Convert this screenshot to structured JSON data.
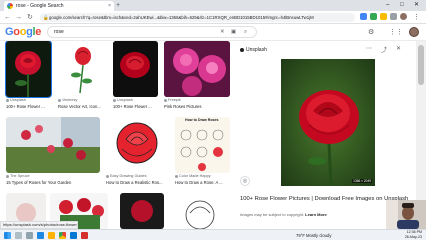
{
  "browser": {
    "tab_title": "rose - Google Search",
    "url": "google.com/search?q=rose&tbm=isch&ved=2ahUKEwi...&biw=1366&bih=625&rlz=1C1RXQR_enBD1015BD1015#imgrc=h4lBnsuwLTw1jM",
    "new_tab": "+",
    "tab_close": "×",
    "controls": {
      "minimize": "–",
      "maximize": "□",
      "close": "✕"
    }
  },
  "google": {
    "logo_letters": [
      {
        "ch": "G",
        "color": "#4285f4"
      },
      {
        "ch": "o",
        "color": "#ea4335"
      },
      {
        "ch": "o",
        "color": "#fbbc05"
      },
      {
        "ch": "g",
        "color": "#4285f4"
      },
      {
        "ch": "l",
        "color": "#34a853"
      },
      {
        "ch": "e",
        "color": "#ea4335"
      }
    ],
    "query": "rose"
  },
  "results": [
    {
      "source": "Unsplash",
      "title": "100+ Rose Flower ..."
    },
    {
      "source": "Vecteezy",
      "title": "Rose Vector Art, Icon..."
    },
    {
      "source": "Unsplash",
      "title": "100+ Rose Flower ..."
    },
    {
      "source": "Freepik",
      "title": "Pink Roses Pictures"
    },
    {
      "source": "The Spruce",
      "title": "15 Types of Roses for Your Garden"
    },
    {
      "source": "Easy Drawing Guides",
      "title": "How to Draw a Realistic Ros..."
    },
    {
      "source": "Color Made Happy",
      "title": "How to Draw a Rose: A ..."
    },
    {
      "source": "",
      "title": ""
    },
    {
      "source": "",
      "title": ""
    },
    {
      "source": "",
      "title": ""
    },
    {
      "source": "",
      "title": ""
    }
  ],
  "panel": {
    "source": "Unsplash",
    "image_size": "1366 × 2049",
    "title": "100+ Rose Flower Pictures | Download Free Images on Unsplash",
    "note_prefix": "Images may be subject to copyright.",
    "learn_more": "Learn More"
  },
  "drawing_card_title": "How to Draw Roses",
  "status_url": "https://unsplash.com/s/photos/rose-flower",
  "taskbar": {
    "weather": "79°F  Mostly cloudy",
    "time": "12:36 PM",
    "date": "26-May-23"
  }
}
